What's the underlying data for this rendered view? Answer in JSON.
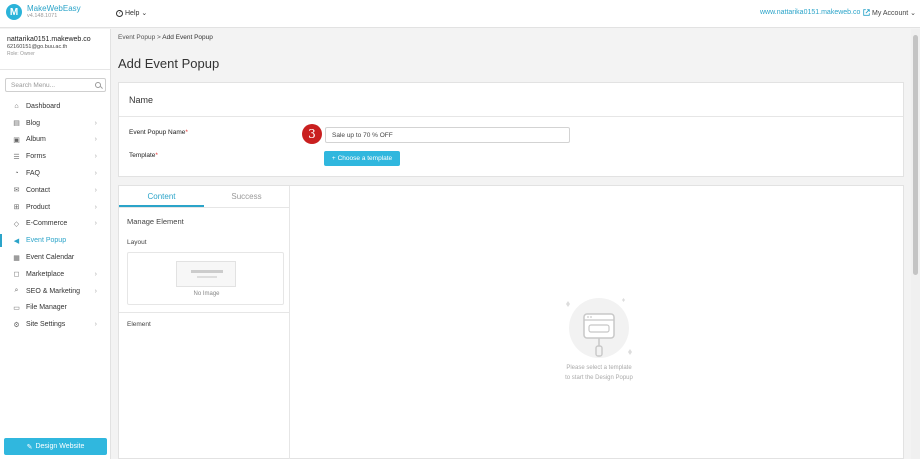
{
  "app": {
    "name": "MakeWebEasy",
    "version": "v4.148.1071"
  },
  "header": {
    "help_label": "Help",
    "site_url": "www.nattarika0151.makeweb.co",
    "account_label": "My Account"
  },
  "user": {
    "name": "nattarika0151.makeweb.co",
    "email": "62160151@go.buu.ac.th",
    "role": "Role: Owner"
  },
  "sidebar": {
    "search_placeholder": "Search Menu...",
    "items": [
      {
        "label": "Dashboard",
        "icon": "home-icon",
        "glyph": "⌂",
        "chevron": false,
        "active": false
      },
      {
        "label": "Blog",
        "icon": "document-icon",
        "glyph": "▤",
        "chevron": true,
        "active": false
      },
      {
        "label": "Album",
        "icon": "image-icon",
        "glyph": "▣",
        "chevron": true,
        "active": false
      },
      {
        "label": "Forms",
        "icon": "list-icon",
        "glyph": "☰",
        "chevron": true,
        "active": false
      },
      {
        "label": "FAQ",
        "icon": "chat-icon",
        "glyph": "◔",
        "chevron": true,
        "active": false
      },
      {
        "label": "Contact",
        "icon": "mail-icon",
        "glyph": "✉",
        "chevron": true,
        "active": false
      },
      {
        "label": "Product",
        "icon": "cart-icon",
        "glyph": "⊞",
        "chevron": true,
        "active": false
      },
      {
        "label": "E-Commerce",
        "icon": "tag-icon",
        "glyph": "◇",
        "chevron": true,
        "active": false
      },
      {
        "label": "Event Popup",
        "icon": "megaphone-icon",
        "glyph": "◀",
        "chevron": false,
        "active": true
      },
      {
        "label": "Event Calendar",
        "icon": "calendar-icon",
        "glyph": "▦",
        "chevron": false,
        "active": false
      },
      {
        "label": "Marketplace",
        "icon": "shopping-bag-icon",
        "glyph": "◻",
        "chevron": true,
        "active": false
      },
      {
        "label": "SEO & Marketing",
        "icon": "search-icon",
        "glyph": "⌕",
        "chevron": true,
        "active": false
      },
      {
        "label": "File Manager",
        "icon": "folder-icon",
        "glyph": "▭",
        "chevron": false,
        "active": false
      },
      {
        "label": "Site Settings",
        "icon": "gear-icon",
        "glyph": "⚙",
        "chevron": true,
        "active": false
      }
    ],
    "design_button_label": "Design Website"
  },
  "breadcrumb": {
    "parent": "Event Popup",
    "separator": " > ",
    "current": "Add Event Popup"
  },
  "page_title": "Add Event Popup",
  "name_section": {
    "title": "Name",
    "popup_name_label": "Event Popup Name",
    "popup_name_value": "Sale up to 70 % OFF",
    "template_label": "Template",
    "required_mark": "*",
    "choose_template_label": "Choose a template",
    "step_number": "3"
  },
  "editor": {
    "tabs": [
      {
        "label": "Content",
        "active": true
      },
      {
        "label": "Success",
        "active": false
      }
    ],
    "manage_element_title": "Manage Element",
    "layout_label": "Layout",
    "no_image_label": "No Image",
    "element_label": "Element",
    "placeholder_line1": "Please select a template",
    "placeholder_line2": "to start the Design Popup"
  },
  "colors": {
    "accent": "#2ba4c9",
    "button": "#30b7de",
    "badge": "#c91f1f",
    "required": "#e03030"
  }
}
